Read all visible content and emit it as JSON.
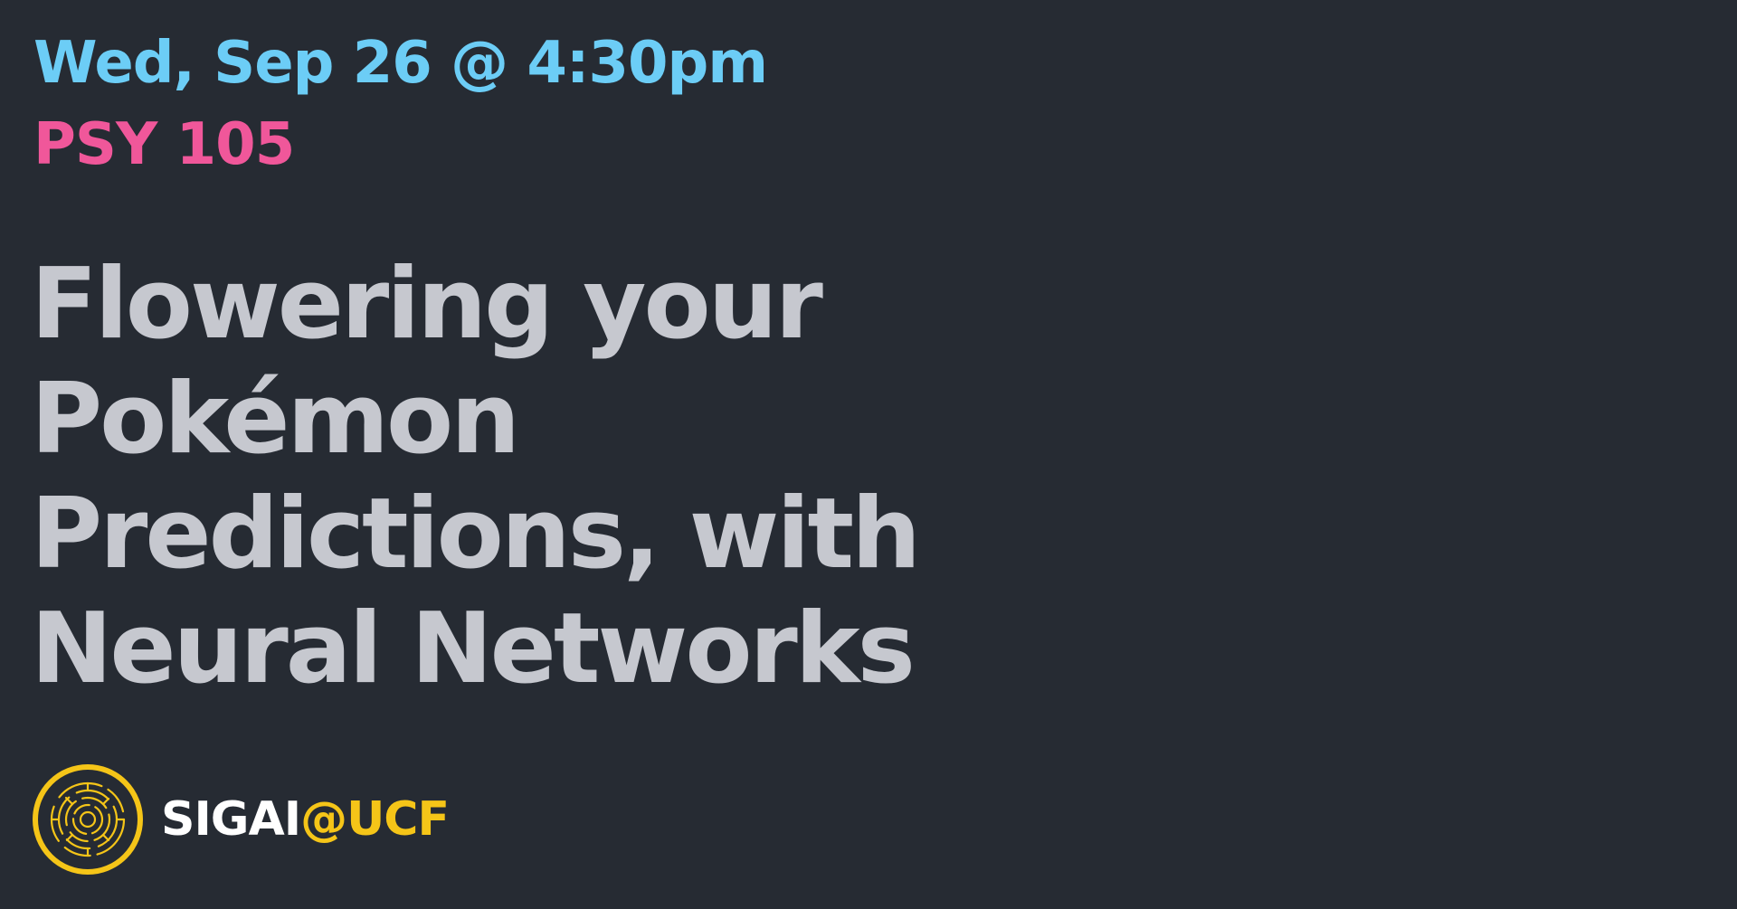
{
  "colors": {
    "background": "#262b33",
    "date": "#6ccdf6",
    "room": "#f0579a",
    "title": "#c6c8cf",
    "brand_primary": "#ffffff",
    "brand_accent": "#f5c518"
  },
  "event": {
    "datetime": "Wed, Sep 26 @ 4:30pm",
    "room": "PSY 105"
  },
  "title": {
    "lines": [
      "Flowering your",
      "Pokémon",
      "Predictions, with",
      "Neural Networks"
    ]
  },
  "brand": {
    "icon": "circuit-circle-logo-icon",
    "name": "SIGAI",
    "suffix": "@UCF"
  }
}
